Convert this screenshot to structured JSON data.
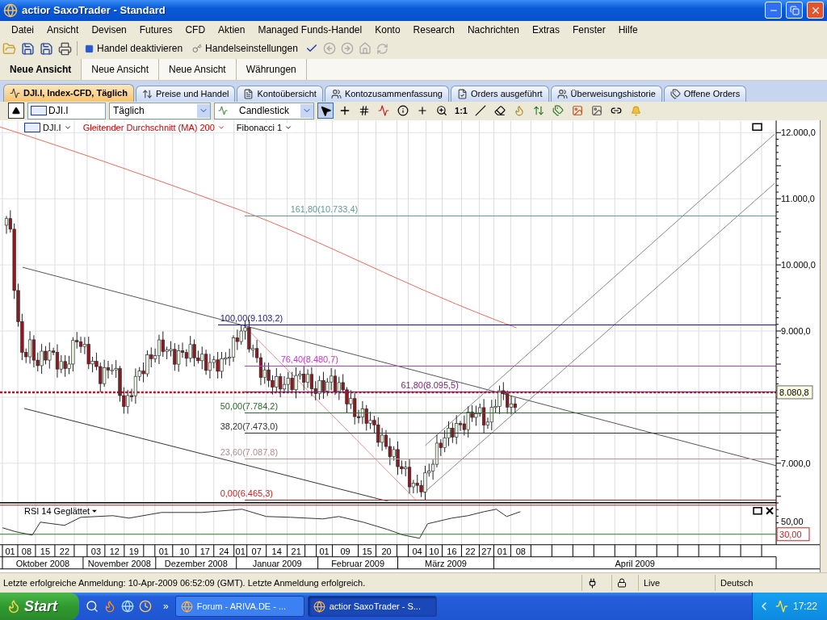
{
  "window": {
    "title": "actior SaxoTrader - Standard"
  },
  "menu": [
    "Datei",
    "Ansicht",
    "Devisen",
    "Futures",
    "CFD",
    "Aktien",
    "Managed Funds-Handel",
    "Konto",
    "Research",
    "Nachrichten",
    "Extras",
    "Fenster",
    "Hilfe"
  ],
  "toolbar": {
    "buttons": [
      "Handel deaktivieren",
      "Handelseinstellungen"
    ]
  },
  "views": [
    {
      "label": "Neue Ansicht",
      "selected": true
    },
    {
      "label": "Neue Ansicht",
      "selected": false
    },
    {
      "label": "Neue Ansicht",
      "selected": false
    },
    {
      "label": "Währungen",
      "selected": false
    }
  ],
  "doc_tabs": [
    {
      "label": "DJI.I, Index-CFD, Täglich",
      "selected": true
    },
    {
      "label": "Preise und Handel",
      "selected": false
    },
    {
      "label": "Kontoübersicht",
      "selected": false
    },
    {
      "label": "Kontozusammenfassung",
      "selected": false
    },
    {
      "label": "Orders ausgeführt",
      "selected": false
    },
    {
      "label": "Überweisungshistorie",
      "selected": false
    },
    {
      "label": "Offene Orders",
      "selected": false
    }
  ],
  "chart_toolbar": {
    "instrument": "DJI.I",
    "period": "Täglich",
    "chart_type": "Candlestick",
    "scale_button": "1:1"
  },
  "legend": [
    {
      "label": "DJI.I",
      "color": "#000000"
    },
    {
      "label": "Gleitender Durchschnitt (MA) 200",
      "color": "#cc0000"
    },
    {
      "label": "Fibonacci 1",
      "color": "#000000"
    }
  ],
  "chart": {
    "y_axis": [
      "12.000,0",
      "11.000,0",
      "10.000,0",
      "9.000,0",
      "7.000,0"
    ],
    "current_price": "8.080,8",
    "fib_levels": [
      {
        "label": "161,80(10.733,4)",
        "color": "#5f9a9a"
      },
      {
        "label": "100,00(9.103,2)",
        "color": "#1a1a8c"
      },
      {
        "label": "76,40(8.480,7)",
        "color": "#cc33cc"
      },
      {
        "label": "61,80(8.095,5)",
        "color": "#7a1f6a"
      },
      {
        "label": "50,00(7.784,2)",
        "color": "#2a6a2a"
      },
      {
        "label": "38,20(7.473,0)",
        "color": "#333333"
      },
      {
        "label": "23,60(7.087,8)",
        "color": "#b09090"
      },
      {
        "label": "0,00(6.465,3)",
        "color": "#cc2020"
      }
    ],
    "rsi": {
      "label": "RSI 14 Geglättet",
      "axis": "50,00",
      "threshold": "30,00"
    },
    "dates": [
      "01",
      "08",
      "15",
      "22",
      "03",
      "12",
      "19",
      "01",
      "10",
      "17",
      "24",
      "01",
      "07",
      "14",
      "21",
      "01",
      "09",
      "15",
      "20",
      "04",
      "10",
      "16",
      "22",
      "27",
      "01",
      "08"
    ],
    "months": [
      "Oktober 2008",
      "November 2008",
      "Dezember 2008",
      "Januar 2009",
      "Februar 2009",
      "März 2009",
      "April 2009"
    ]
  },
  "status_bar": {
    "message": "Letzte erfolgreiche Anmeldung: 10-Apr-2009 06:52:09 (GMT). Letzte Anmeldung erfolgreich.",
    "connection": "Live",
    "language": "Deutsch"
  },
  "taskbar": {
    "start": "Start",
    "more": "»",
    "tasks": [
      {
        "label": "Forum - ARIVA.DE - ...",
        "selected": false
      },
      {
        "label": "actior SaxoTrader - S...",
        "selected": true
      }
    ],
    "clock": "17:22"
  }
}
